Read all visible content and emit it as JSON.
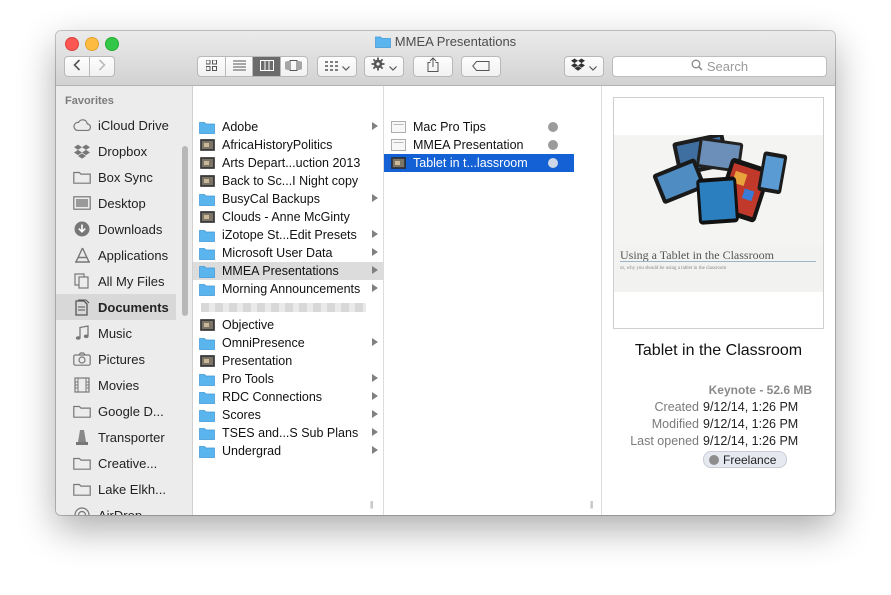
{
  "window": {
    "title": "MMEA Presentations"
  },
  "toolbar": {
    "search_placeholder": "Search"
  },
  "sidebar": {
    "heading": "Favorites",
    "items": [
      {
        "label": "iCloud Drive",
        "icon": "cloud-icon"
      },
      {
        "label": "Dropbox",
        "icon": "dropbox-icon"
      },
      {
        "label": "Box Sync",
        "icon": "folder-icon"
      },
      {
        "label": "Desktop",
        "icon": "desktop-icon"
      },
      {
        "label": "Downloads",
        "icon": "download-icon"
      },
      {
        "label": "Applications",
        "icon": "applications-icon"
      },
      {
        "label": "All My Files",
        "icon": "all-files-icon"
      },
      {
        "label": "Documents",
        "icon": "documents-icon",
        "selected": true
      },
      {
        "label": "Music",
        "icon": "music-icon"
      },
      {
        "label": "Pictures",
        "icon": "camera-icon"
      },
      {
        "label": "Movies",
        "icon": "film-icon"
      },
      {
        "label": "Google D...",
        "icon": "folder-icon"
      },
      {
        "label": "Transporter",
        "icon": "transporter-icon"
      },
      {
        "label": "Creative...",
        "icon": "folder-icon"
      },
      {
        "label": "Lake Elkh...",
        "icon": "folder-icon"
      },
      {
        "label": "AirDrop",
        "icon": "airdrop-icon"
      }
    ]
  },
  "column1": {
    "items": [
      {
        "label": "Adobe",
        "type": "folder"
      },
      {
        "label": "AfricaHistoryPolitics",
        "type": "file"
      },
      {
        "label": "Arts Depart...uction 2013",
        "type": "file"
      },
      {
        "label": "Back to Sc...I Night copy",
        "type": "file"
      },
      {
        "label": "BusyCal Backups",
        "type": "folder"
      },
      {
        "label": "Clouds - Anne McGinty",
        "type": "file"
      },
      {
        "label": "iZotope St...Edit Presets",
        "type": "folder"
      },
      {
        "label": "Microsoft User Data",
        "type": "folder"
      },
      {
        "label": "MMEA Presentations",
        "type": "folder",
        "selected": true
      },
      {
        "label": "Morning Announcements",
        "type": "folder"
      },
      {
        "label": "",
        "type": "blurred"
      },
      {
        "label": "Objective",
        "type": "file"
      },
      {
        "label": "OmniPresence",
        "type": "folder"
      },
      {
        "label": "Presentation",
        "type": "file"
      },
      {
        "label": "Pro Tools",
        "type": "folder"
      },
      {
        "label": "RDC Connections",
        "type": "folder"
      },
      {
        "label": "Scores",
        "type": "folder"
      },
      {
        "label": "TSES and...S Sub Plans",
        "type": "folder"
      },
      {
        "label": "Undergrad",
        "type": "folder"
      }
    ]
  },
  "column2": {
    "items": [
      {
        "label": "Mac Pro Tips"
      },
      {
        "label": "MMEA Presentation"
      },
      {
        "label": "Tablet in t...lassroom",
        "selected": true
      }
    ]
  },
  "preview": {
    "slide_title": "Using a Tablet in the Classroom",
    "slide_subtitle": "or, why you should be using a tablet in the classroom",
    "name": "Tablet in the Classroom",
    "kind": "Keynote - 52.6 MB",
    "created_label": "Created",
    "created": "9/12/14, 1:26 PM",
    "modified_label": "Modified",
    "modified": "9/12/14, 1:26 PM",
    "opened_label": "Last opened",
    "opened": "9/12/14, 1:26 PM",
    "tag": "Freelance"
  },
  "colors": {
    "selection_blue": "#1361d4",
    "tag_grey": "#8d8d8d"
  }
}
